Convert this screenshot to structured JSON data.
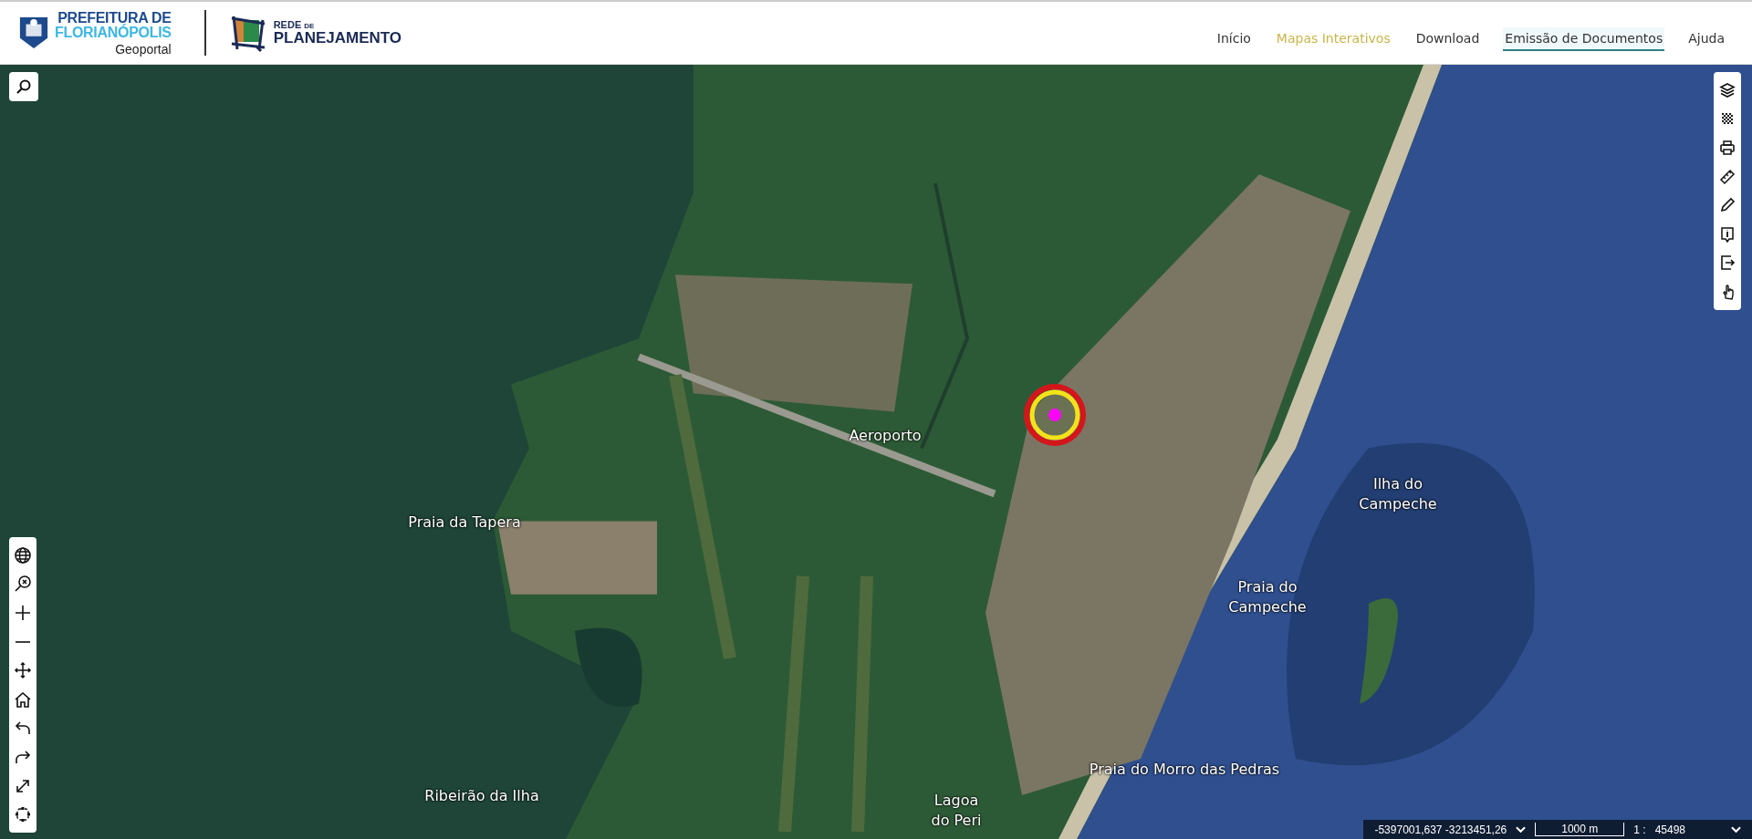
{
  "header": {
    "logo_line1": "PREFEITURA DE",
    "logo_line2": "FLORIANÓPOLIS",
    "logo_subtitle": "Geoportal",
    "partner_line1": "REDE",
    "partner_line1_small": "DE",
    "partner_line2": "PLANEJAMENTO"
  },
  "nav": [
    {
      "label": "Início",
      "selected": false,
      "underlined": false
    },
    {
      "label": "Mapas Interativos",
      "selected": true,
      "underlined": false
    },
    {
      "label": "Download",
      "selected": false,
      "underlined": false
    },
    {
      "label": "Emissão de Documentos",
      "selected": false,
      "underlined": true
    },
    {
      "label": "Ajuda",
      "selected": false,
      "underlined": false
    }
  ],
  "map": {
    "labels": [
      {
        "lines": [
          "Aeroporto"
        ]
      },
      {
        "lines": [
          "Praia da Tapera"
        ]
      },
      {
        "lines": [
          "Ilha do",
          "Campeche"
        ]
      },
      {
        "lines": [
          "Praia do",
          "Campeche"
        ]
      },
      {
        "lines": [
          "Praia do Morro das Pedras"
        ]
      },
      {
        "lines": [
          "Ribeirão da Ilha"
        ]
      },
      {
        "lines": [
          "Lagoa",
          "do Peri"
        ]
      }
    ]
  },
  "status_bar": {
    "coordinates": "-5397001,637 -3213451,26",
    "scale_bar": "1000 m",
    "scale_prefix": "1 :",
    "scale": "45498"
  }
}
